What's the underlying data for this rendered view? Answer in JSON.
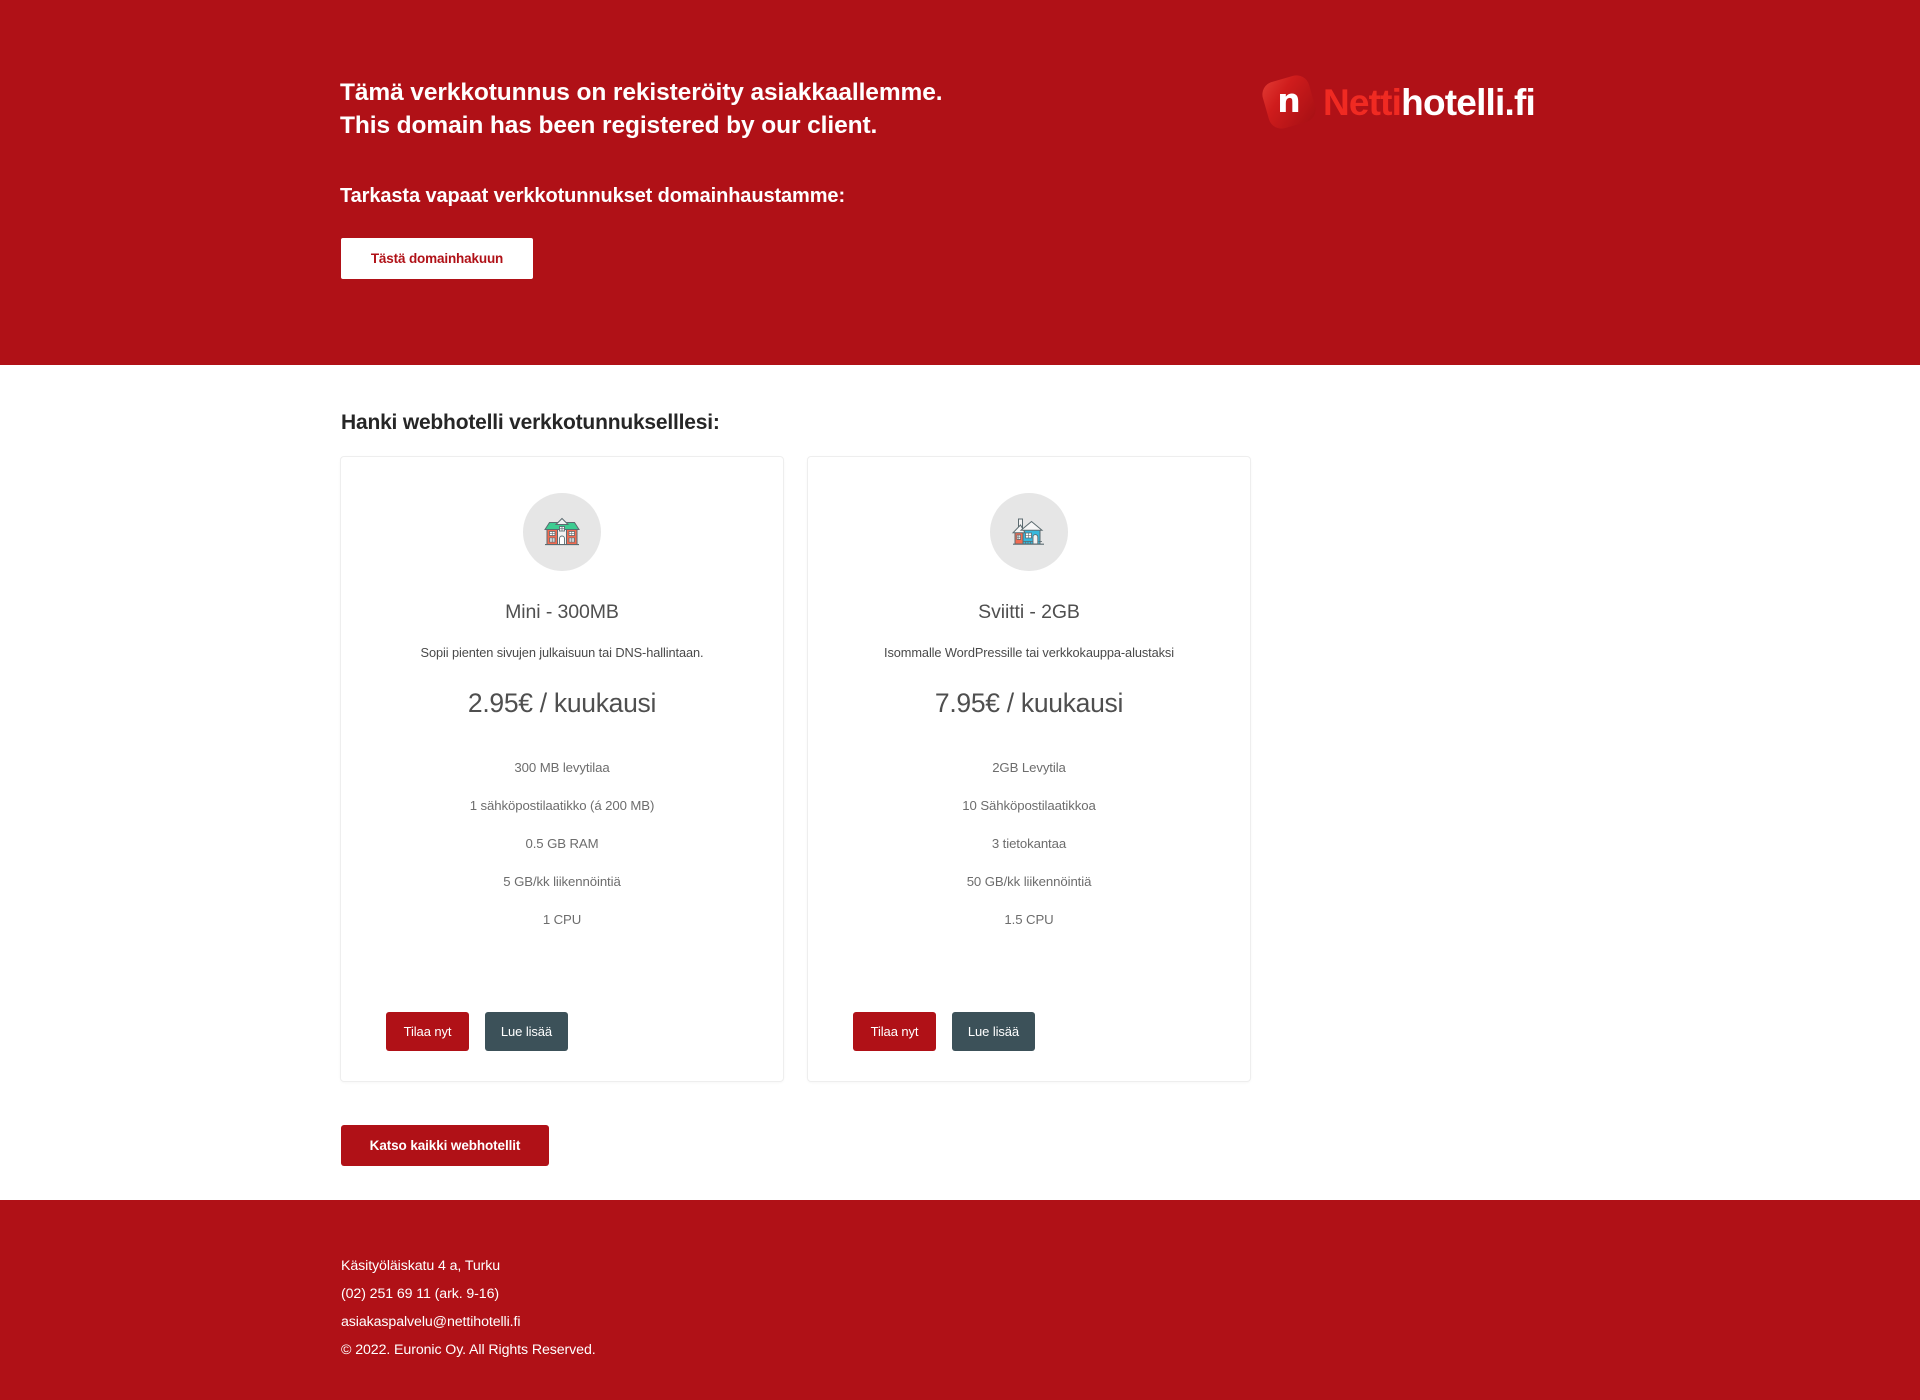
{
  "colors": {
    "brand_red": "#b01117",
    "logo_red": "#f02a22",
    "dark_slate": "#3c5159",
    "card_border": "#eeeeee",
    "icon_circle": "#e6e6e6",
    "roof_green": "#3dcc91",
    "wall_orange": "#f26b51",
    "wall_blue": "#36b8dd"
  },
  "header": {
    "headline_line1": "Tämä verkkotunnus on rekisteröity asiakkaallemme.",
    "headline_line2": "This domain has been registered by our client.",
    "subline": "Tarkasta vapaat verkkotunnukset domainhaustamme:",
    "domain_button": "Tästä domainhakuun",
    "logo": {
      "mark_glyph": "n",
      "text_part1": "Netti",
      "text_part2": "hotelli.fi"
    }
  },
  "main": {
    "section_title": "Hanki webhotelli verkkotunnukselllesi:",
    "all_plans_button": "Katso kaikki webhotellit",
    "plans": [
      {
        "icon": "house-green-roof-icon",
        "name": "Mini - 300MB",
        "description": "Sopii pienten sivujen julkaisuun tai DNS-hallintaan.",
        "price": "2.95€ / kuukausi",
        "features": [
          "300 MB levytilaa",
          "1 sähköpostilaatikko (á 200 MB)",
          "0.5 GB RAM",
          "5 GB/kk liikennöintiä",
          "1 CPU"
        ],
        "order_button": "Tilaa nyt",
        "more_button": "Lue lisää"
      },
      {
        "icon": "house-blue-wall-icon",
        "name": "Sviitti - 2GB",
        "description": "Isommalle WordPressille tai verkkokauppa-alustaksi",
        "price": "7.95€ / kuukausi",
        "features": [
          "2GB Levytila",
          "10 Sähköpostilaatikkoa",
          "3 tietokantaa",
          "50 GB/kk liikennöintiä",
          "1.5 CPU"
        ],
        "order_button": "Tilaa nyt",
        "more_button": "Lue lisää"
      }
    ]
  },
  "footer": {
    "address": "Käsityöläiskatu 4 a, Turku",
    "phone": "(02) 251 69 11 (ark. 9-16)",
    "email": "asiakaspalvelu@nettihotelli.fi",
    "copyright": "© 2022. Euronic Oy. All Rights Reserved."
  }
}
